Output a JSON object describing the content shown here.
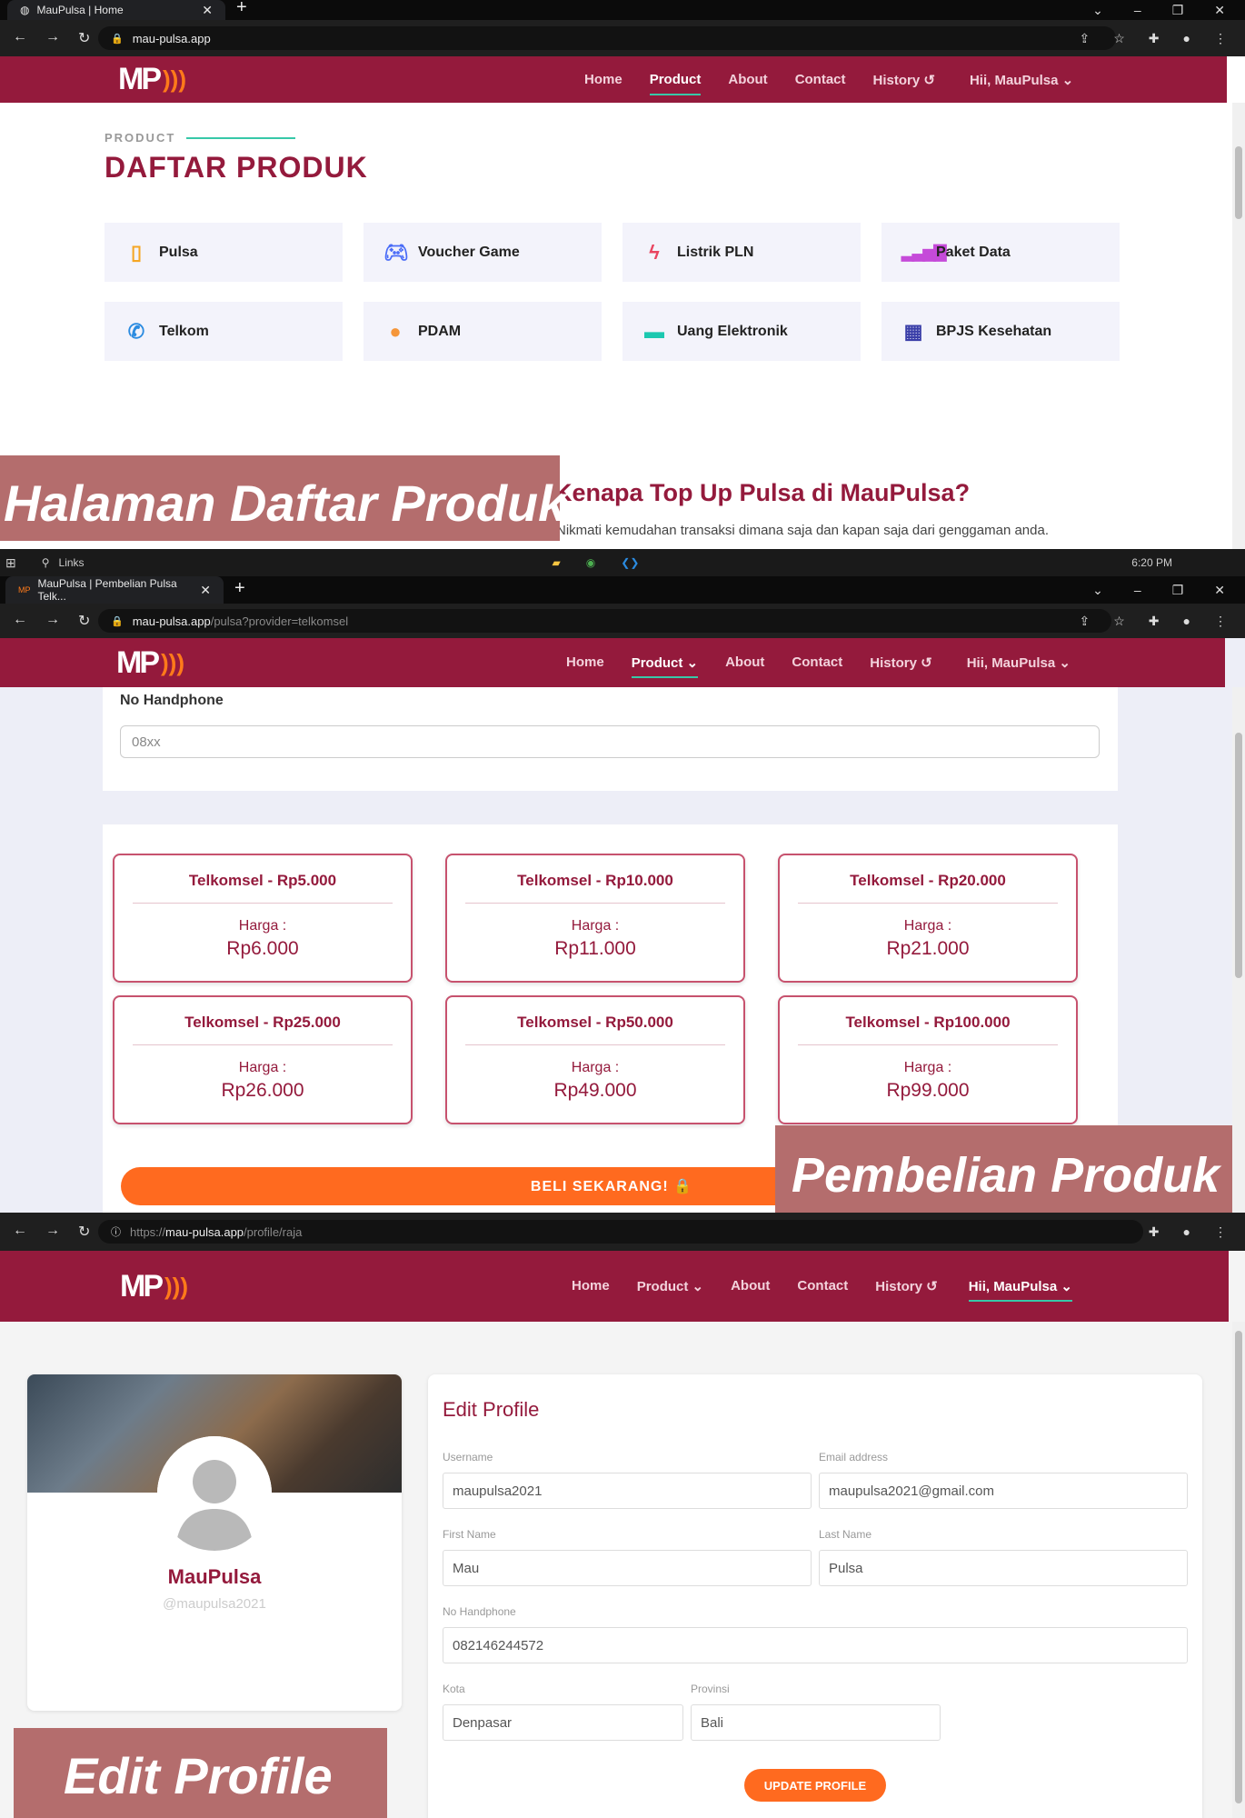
{
  "s1": {
    "tab_title": "MauPulsa | Home",
    "url": "mau-pulsa.app",
    "logo": "MP",
    "menu": {
      "home": "Home",
      "product": "Product",
      "about": "About",
      "contact": "Contact",
      "history": "History ↺",
      "user": "Hii, MauPulsa ⌄"
    },
    "kicker": "PRODUCT",
    "title": "DAFTAR PRODUK",
    "products": [
      {
        "label": "Pulsa",
        "icon": "phone-icon"
      },
      {
        "label": "Voucher Game",
        "icon": "gamepad-icon"
      },
      {
        "label": "Listrik PLN",
        "icon": "lightning-icon"
      },
      {
        "label": "Paket Data",
        "icon": "signal-bars-icon"
      },
      {
        "label": "Telkom",
        "icon": "telephone-icon"
      },
      {
        "label": "PDAM",
        "icon": "water-drop-icon"
      },
      {
        "label": "Uang Elektronik",
        "icon": "wallet-icon"
      },
      {
        "label": "BPJS Kesehatan",
        "icon": "hospital-icon"
      }
    ],
    "why_title": "Kenapa Top Up Pulsa di MauPulsa?",
    "why_sub": "Nikmati kemudahan transaksi dimana saja dan kapan saja dari genggaman anda.",
    "banner": "Halaman Daftar Produk",
    "taskbar": {
      "search": "Links",
      "time": "6:20 PM"
    }
  },
  "s2": {
    "tab_title": "MauPulsa | Pembelian Pulsa Telk...",
    "url_host": "mau-pulsa.app",
    "url_path": "/pulsa?provider=telkomsel",
    "menu": {
      "home": "Home",
      "product": "Product ⌄",
      "about": "About",
      "contact": "Contact",
      "history": "History ↺",
      "user": "Hii, MauPulsa ⌄"
    },
    "phone_label": "No Handphone",
    "phone_placeholder": "08xx",
    "vouchers": [
      {
        "title": "Telkomsel - Rp5.000",
        "harga_label": "Harga :",
        "price": "Rp6.000"
      },
      {
        "title": "Telkomsel - Rp10.000",
        "harga_label": "Harga :",
        "price": "Rp11.000"
      },
      {
        "title": "Telkomsel - Rp20.000",
        "harga_label": "Harga :",
        "price": "Rp21.000"
      },
      {
        "title": "Telkomsel - Rp25.000",
        "harga_label": "Harga :",
        "price": "Rp26.000"
      },
      {
        "title": "Telkomsel - Rp50.000",
        "harga_label": "Harga :",
        "price": "Rp49.000"
      },
      {
        "title": "Telkomsel - Rp100.000",
        "harga_label": "Harga :",
        "price": "Rp99.000"
      }
    ],
    "buy": "BELI SEKARANG! 🔒",
    "banner": "Pembelian Produk"
  },
  "s3": {
    "url_scheme": "https://",
    "url_host": "mau-pulsa.app",
    "url_path": "/profile/raja",
    "menu": {
      "home": "Home",
      "product": "Product ⌄",
      "about": "About",
      "contact": "Contact",
      "history": "History ↺",
      "user": "Hii, MauPulsa ⌄"
    },
    "name": "MauPulsa",
    "handle": "@maupulsa2021",
    "edit_title": "Edit Profile",
    "fields": {
      "username": {
        "label": "Username",
        "value": "maupulsa2021"
      },
      "email": {
        "label": "Email address",
        "value": "maupulsa2021@gmail.com"
      },
      "first": {
        "label": "First Name",
        "value": "Mau"
      },
      "last": {
        "label": "Last Name",
        "value": "Pulsa"
      },
      "phone": {
        "label": "No Handphone",
        "value": "082146244572"
      },
      "kota": {
        "label": "Kota",
        "value": "Denpasar"
      },
      "provinsi": {
        "label": "Provinsi",
        "value": "Bali"
      }
    },
    "update": "UPDATE PROFILE",
    "banner": "Edit Profile"
  },
  "colors": {
    "brand": "#941a3c",
    "accent": "#ff6a1f",
    "teal": "#37c8a8",
    "banner": "#b46d6d"
  }
}
